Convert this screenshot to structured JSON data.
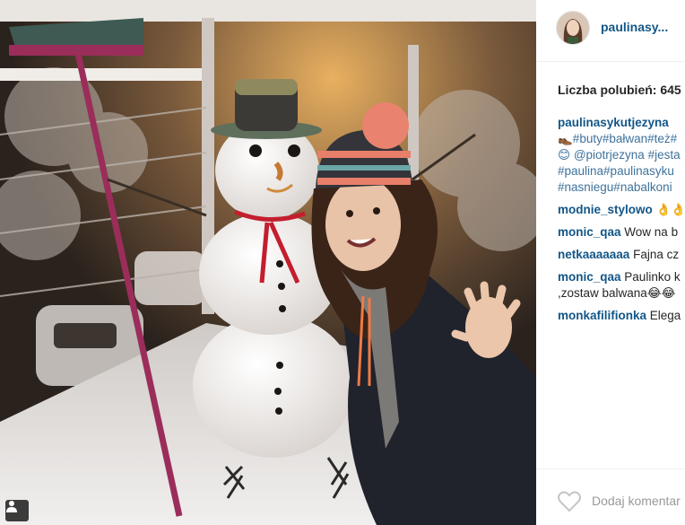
{
  "post": {
    "photo_alt": "",
    "user_tag_icon": "person-icon"
  },
  "header": {
    "username": "paulinasy..."
  },
  "likes": {
    "text": "Liczba polubień: 645"
  },
  "caption": {
    "author": "paulinasykutjezyna",
    "lines": [
      "👞#buty#bałwan#też#",
      "😊 @piotrjezyna #jesta",
      "#paulina#paulinasyku",
      "#nasniegu#nabalkoni"
    ]
  },
  "comments": [
    {
      "author": "modnie_stylowo",
      "text": "👌👌"
    },
    {
      "author": "monic_qaa",
      "text": "Wow na b"
    },
    {
      "author": "netkaaaaaaa",
      "text": "Fajna cz"
    },
    {
      "author": "monic_qaa",
      "text": "Paulinko k",
      "text2": ",zostaw balwana😂😂"
    },
    {
      "author": "monkafilifionka",
      "text": "Elega"
    }
  ],
  "add_comment": {
    "placeholder": "Dodaj komentar"
  },
  "colors": {
    "link": "#125688",
    "hashtag": "#3f729b"
  }
}
